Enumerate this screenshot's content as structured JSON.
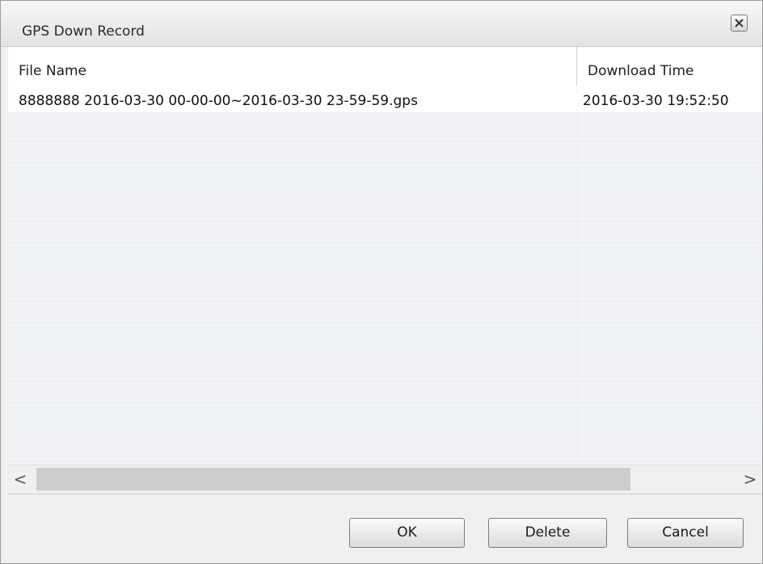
{
  "window": {
    "title": "GPS Down Record",
    "close_icon": "close-icon"
  },
  "table": {
    "columns": [
      "File Name",
      "Download Time"
    ],
    "rows": [
      {
        "file_name": "8888888 2016-03-30 00-00-00~2016-03-30 23-59-59.gps",
        "download_time": "2016-03-30 19:52:50"
      }
    ]
  },
  "scrollbar": {
    "left_arrow": "<",
    "right_arrow": ">"
  },
  "buttons": {
    "ok": "OK",
    "delete": "Delete",
    "cancel": "Cancel"
  }
}
